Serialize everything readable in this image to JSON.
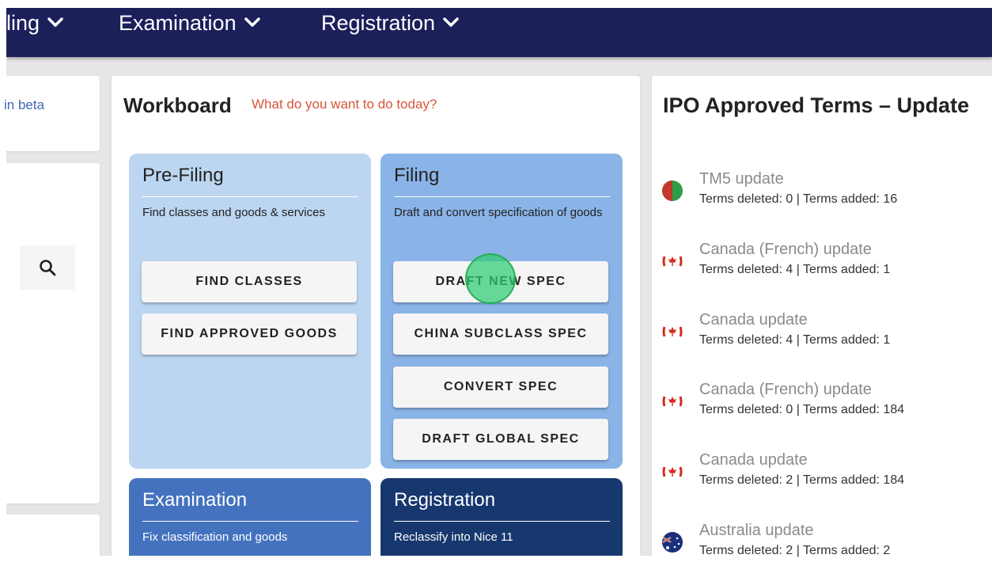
{
  "nav": {
    "items": [
      {
        "label": "ling"
      },
      {
        "label": "Examination"
      },
      {
        "label": "Registration"
      }
    ]
  },
  "left": {
    "beta_text": "in beta",
    "search_icon": "search-icon"
  },
  "workboard": {
    "title": "Workboard",
    "subtitle": "What do you want to do today?",
    "prefiling": {
      "title": "Pre-Filing",
      "desc": "Find classes and goods & services",
      "buttons": [
        "FIND CLASSES",
        "FIND APPROVED GOODS"
      ]
    },
    "filing": {
      "title": "Filing",
      "desc": "Draft and convert specification of goods",
      "buttons": [
        "DRAFT NEW SPEC",
        "CHINA SUBCLASS SPEC",
        "CONVERT SPEC",
        "DRAFT GLOBAL SPEC"
      ]
    },
    "examination": {
      "title": "Examination",
      "desc": "Fix classification and goods"
    },
    "registration": {
      "title": "Registration",
      "desc": "Reclassify into Nice 11"
    }
  },
  "ipo": {
    "title": "IPO Approved Terms – Update",
    "updates": [
      {
        "title": "TM5 update",
        "detail": "Terms deleted: 0 | Terms added: 16",
        "flag": "tm5-icon"
      },
      {
        "title": "Canada (French) update",
        "detail": "Terms deleted: 4 | Terms added: 1",
        "flag": "canada-flag-icon"
      },
      {
        "title": "Canada update",
        "detail": "Terms deleted: 4 | Terms added: 1",
        "flag": "canada-flag-icon"
      },
      {
        "title": "Canada (French) update",
        "detail": "Terms deleted: 0 | Terms added: 184",
        "flag": "canada-flag-icon"
      },
      {
        "title": "Canada update",
        "detail": "Terms deleted: 2 | Terms added: 184",
        "flag": "canada-flag-icon"
      },
      {
        "title": "Australia update",
        "detail": "Terms deleted: 2 | Terms added: 2",
        "flag": "australia-flag-icon"
      }
    ]
  },
  "colors": {
    "nav_bg": "#1b1f5a",
    "page_bg": "#e6e6e6",
    "prefiling_bg": "#bcd6f1",
    "filing_bg": "#8ab4e7",
    "examination_bg": "#4472bf",
    "registration_bg": "#17376f",
    "accent_red": "#d9553b",
    "click_marker": "#2ecc71"
  }
}
